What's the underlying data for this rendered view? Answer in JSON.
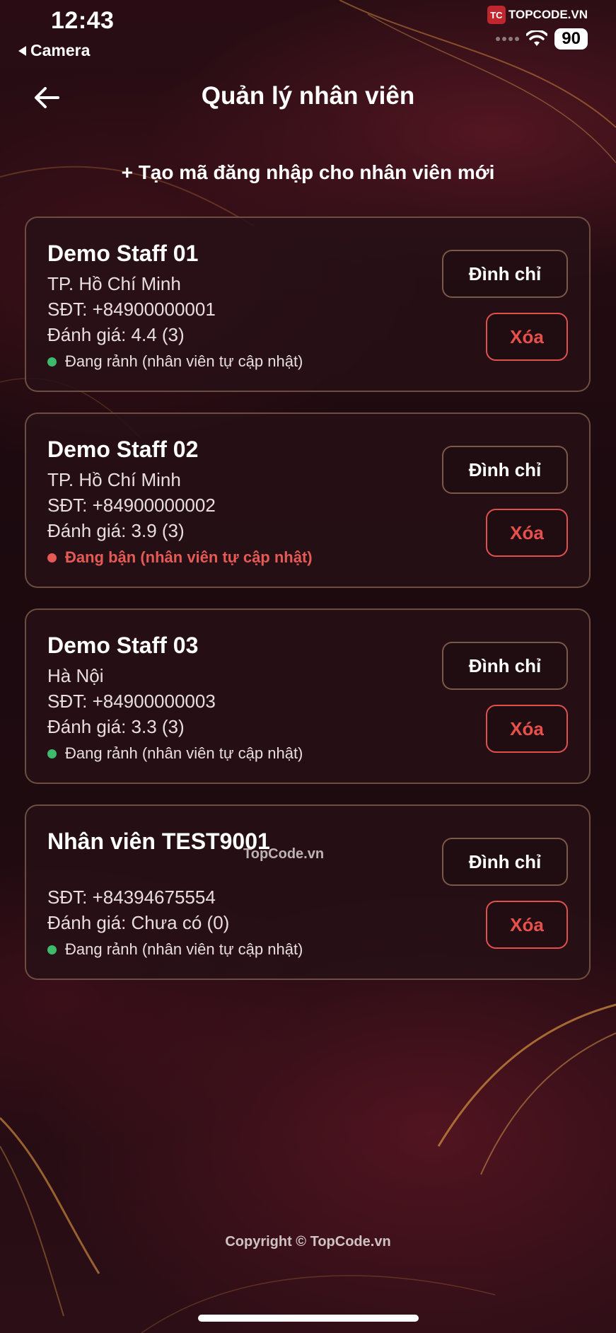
{
  "status_bar": {
    "time": "12:43",
    "back_app": "Camera",
    "logo_text": "TOPCODE.VN",
    "logo_mark": "TC",
    "battery": "90"
  },
  "nav": {
    "title": "Quản lý nhân viên",
    "back_icon": "arrow-left-icon"
  },
  "create_label": "+ Tạo mã đăng nhập cho nhân viên mới",
  "staff": [
    {
      "name": "Demo Staff 01",
      "city": "TP. Hồ Chí Minh",
      "phone": "SĐT: +84900000001",
      "rating": "Đánh giá: 4.4 (3)",
      "status": "Đang rảnh (nhân viên tự cập nhật)",
      "suspend": "Đình chỉ",
      "delete": "Xóa"
    },
    {
      "name": "Demo Staff 02",
      "city": "TP. Hồ Chí Minh",
      "phone": "SĐT: +84900000002",
      "rating": "Đánh giá: 3.9 (3)",
      "status": "Đang bận (nhân viên tự cập nhật)",
      "suspend": "Đình chỉ",
      "delete": "Xóa"
    },
    {
      "name": "Demo Staff 03",
      "city": "Hà Nội",
      "phone": "SĐT: +84900000003",
      "rating": "Đánh giá: 3.3 (3)",
      "status": "Đang rảnh (nhân viên tự cập nhật)",
      "suspend": "Đình chỉ",
      "delete": "Xóa"
    },
    {
      "name": "Nhân viên TEST9001",
      "city": "",
      "phone": "SĐT: +84394675554",
      "rating": "Đánh giá: Chưa có (0)",
      "status": "Đang rảnh (nhân viên tự cập nhật)",
      "suspend": "Đình chỉ",
      "delete": "Xóa"
    }
  ],
  "watermark": "TopCode.vn",
  "footer": "Copyright © TopCode.vn",
  "colors": {
    "available": "#3dba6b",
    "busy": "#e65a55",
    "delete": "#e0504d"
  }
}
